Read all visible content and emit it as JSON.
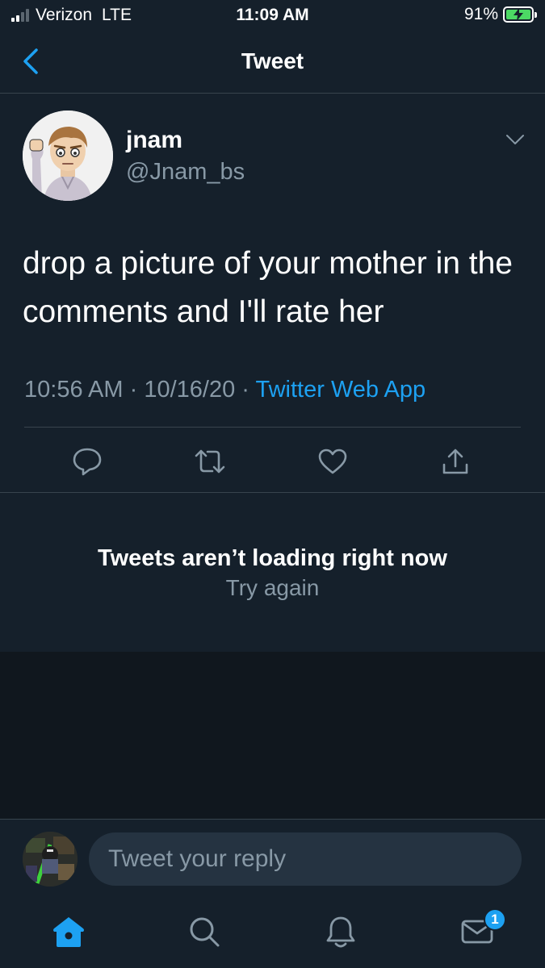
{
  "status_bar": {
    "carrier": "Verizon",
    "network": "LTE",
    "time": "11:09 AM",
    "battery_percent": "91%",
    "battery_level": 0.91,
    "signal_bars": 2
  },
  "header": {
    "back_icon": "chevron-left-icon",
    "title": "Tweet"
  },
  "tweet": {
    "author_name": "jnam",
    "author_handle": "@Jnam_bs",
    "text": "drop a picture of your mother in the comments and I'll rate her",
    "time": "10:56 AM",
    "date": "10/16/20",
    "separator": "·",
    "source": "Twitter Web App",
    "actions": [
      "reply-icon",
      "retweet-icon",
      "like-icon",
      "share-icon"
    ]
  },
  "error": {
    "title": "Tweets aren’t loading right now",
    "retry_label": "Try again"
  },
  "reply": {
    "placeholder": "Tweet your reply"
  },
  "tab_bar": {
    "tabs": [
      "home-icon",
      "search-icon",
      "notifications-icon",
      "messages-icon"
    ],
    "messages_badge": "1"
  },
  "colors": {
    "background": "#15202b",
    "accent": "#1da1f2",
    "secondary_text": "#8899a6",
    "divider": "#38444d",
    "battery_fill": "#4cd964"
  }
}
